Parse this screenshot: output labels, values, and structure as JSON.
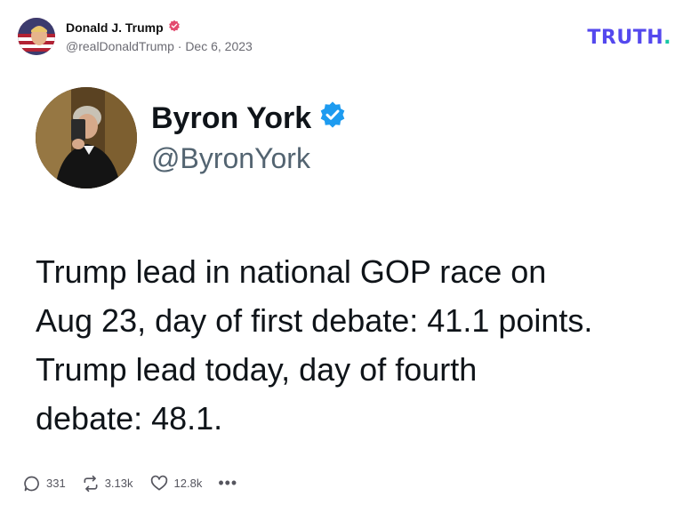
{
  "post": {
    "author_name": "Donald J. Trump",
    "author_handle": "@realDonaldTrump",
    "separator": "·",
    "date": "Dec 6, 2023"
  },
  "brand": {
    "text": "TRUTH",
    "dot": ".",
    "color": "#5448ee",
    "dot_color": "#16c6a4"
  },
  "embedded_tweet": {
    "name": "Byron York",
    "handle": "@ByronYork",
    "lines": [
      "Trump lead in national GOP race on",
      "Aug 23, day of first debate: 41.1 points.",
      "Trump lead today, day of fourth",
      "debate: 48.1."
    ]
  },
  "actions": {
    "replies": "331",
    "retruths": "3.13k",
    "likes": "12.8k",
    "more": "•••"
  },
  "colors": {
    "verified_pink": "#e34a6f",
    "verified_blue": "#1d9bf0",
    "text_muted": "#6b6b73"
  }
}
